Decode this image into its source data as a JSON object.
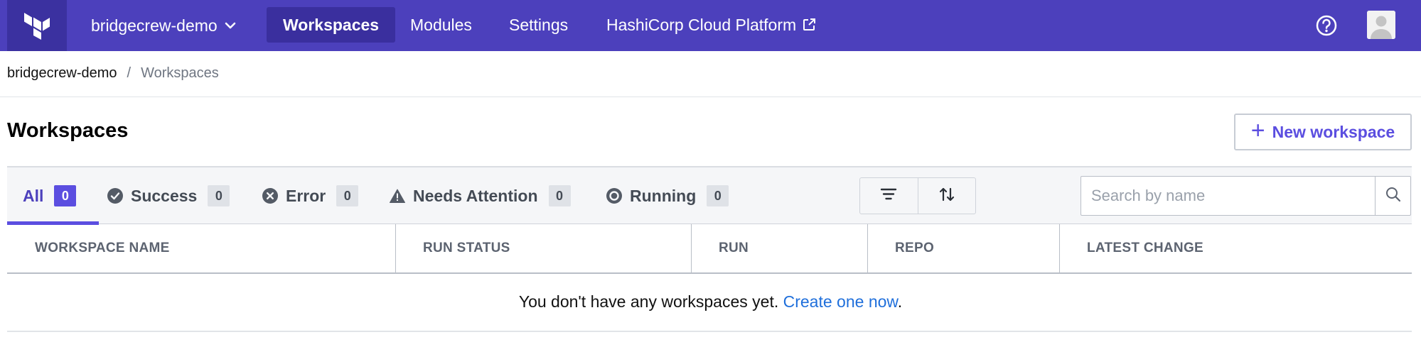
{
  "nav": {
    "org_name": "bridgecrew-demo",
    "items": [
      {
        "label": "Workspaces"
      },
      {
        "label": "Modules"
      },
      {
        "label": "Settings"
      },
      {
        "label": "HashiCorp Cloud Platform"
      }
    ],
    "colors": {
      "bar": "#4c40bc",
      "logo_box": "#3b31a0",
      "active_item": "#3a2f9e"
    }
  },
  "breadcrumb": {
    "org": "bridgecrew-demo",
    "separator": "/",
    "current": "Workspaces"
  },
  "page": {
    "title": "Workspaces",
    "new_button_icon": "+",
    "new_button_label": "New workspace"
  },
  "filters": {
    "tabs": [
      {
        "label": "All",
        "count": "0",
        "icon": ""
      },
      {
        "label": "Success",
        "count": "0",
        "icon": "check-circle-icon"
      },
      {
        "label": "Error",
        "count": "0",
        "icon": "x-circle-icon"
      },
      {
        "label": "Needs Attention",
        "count": "0",
        "icon": "warning-triangle-icon"
      },
      {
        "label": "Running",
        "count": "0",
        "icon": "running-circle-icon"
      }
    ],
    "search_placeholder": "Search by name",
    "accent": "#5b4ee0"
  },
  "table": {
    "columns": [
      "WORKSPACE NAME",
      "RUN STATUS",
      "RUN",
      "REPO",
      "LATEST CHANGE"
    ],
    "empty_text": "You don't have any workspaces yet.",
    "empty_link": "Create one now",
    "empty_end": ".",
    "link_color": "#1f6fdb"
  }
}
